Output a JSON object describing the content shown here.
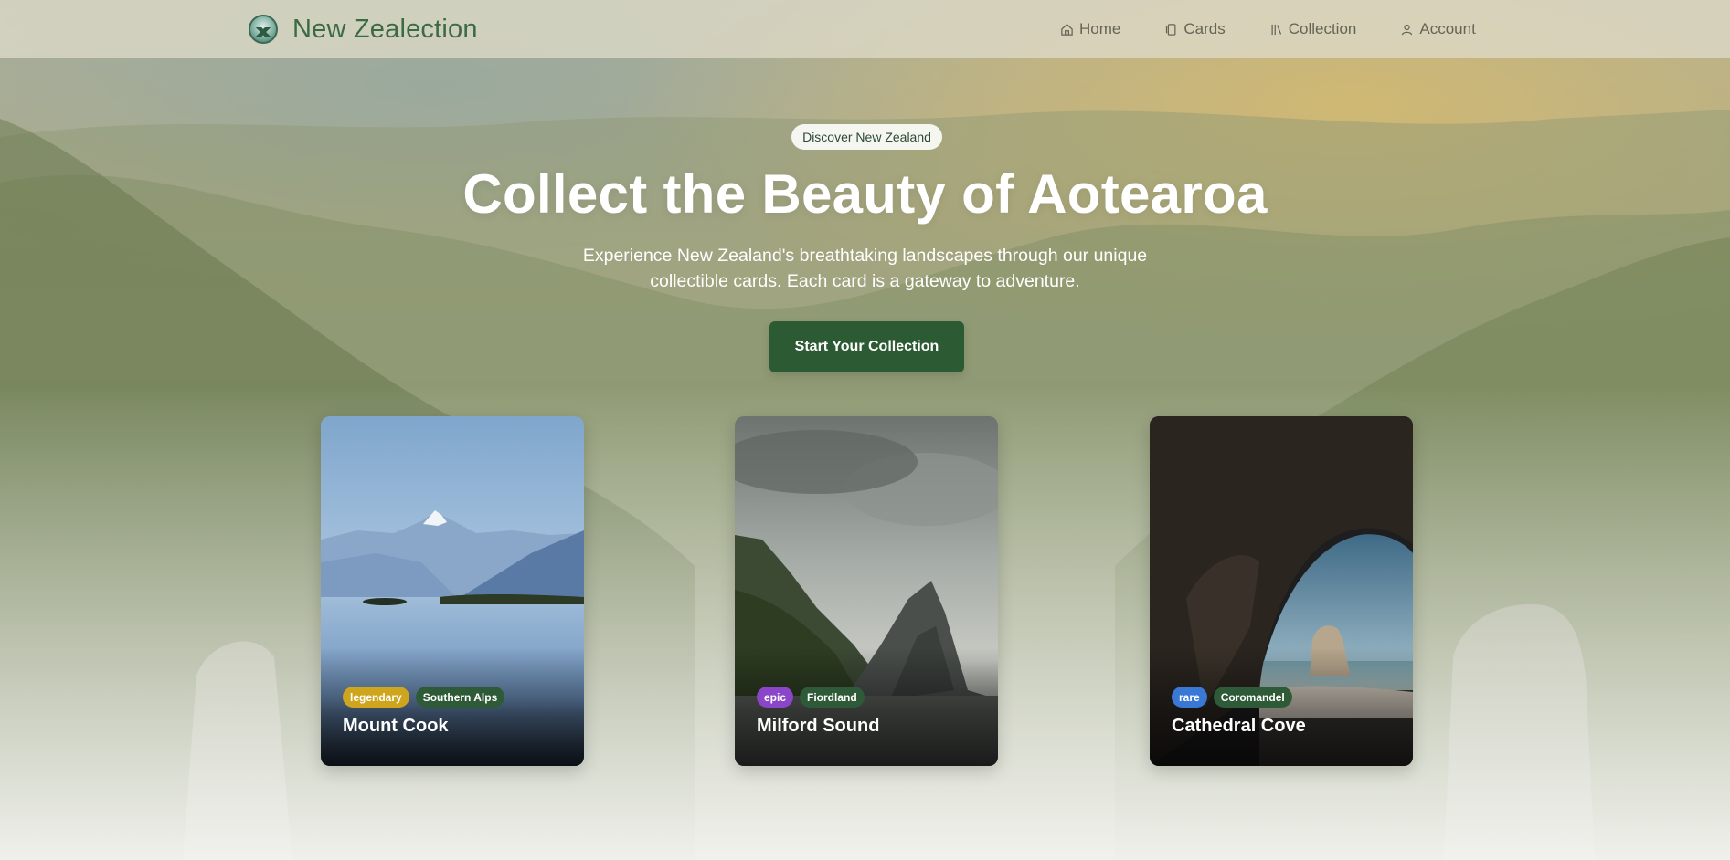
{
  "brand": {
    "name": "New Zealection",
    "logo_icon": "compass-globe-icon"
  },
  "nav": {
    "items": [
      {
        "label": "Home",
        "icon": "home-icon"
      },
      {
        "label": "Cards",
        "icon": "cards-icon"
      },
      {
        "label": "Collection",
        "icon": "library-icon"
      },
      {
        "label": "Account",
        "icon": "user-icon"
      }
    ]
  },
  "hero": {
    "badge": "Discover New Zealand",
    "title": "Collect the Beauty of Aotearoa",
    "subtitle_line1": "Experience New Zealand's breathtaking landscapes through our unique",
    "subtitle_line2": "collectible cards. Each card is a gateway to adventure.",
    "cta_label": "Start Your Collection"
  },
  "cards": [
    {
      "title": "Mount Cook",
      "rarity": "legendary",
      "region": "Southern Alps",
      "rarity_color": "#cfa51e"
    },
    {
      "title": "Milford Sound",
      "rarity": "epic",
      "region": "Fiordland",
      "rarity_color": "#8a45c9"
    },
    {
      "title": "Cathedral Cove",
      "rarity": "rare",
      "region": "Coromandel",
      "rarity_color": "#3a78d6"
    }
  ],
  "colors": {
    "brand_green": "#3b6b45",
    "cta_green": "#2b5a33",
    "region_tag": "#2f5a38"
  }
}
